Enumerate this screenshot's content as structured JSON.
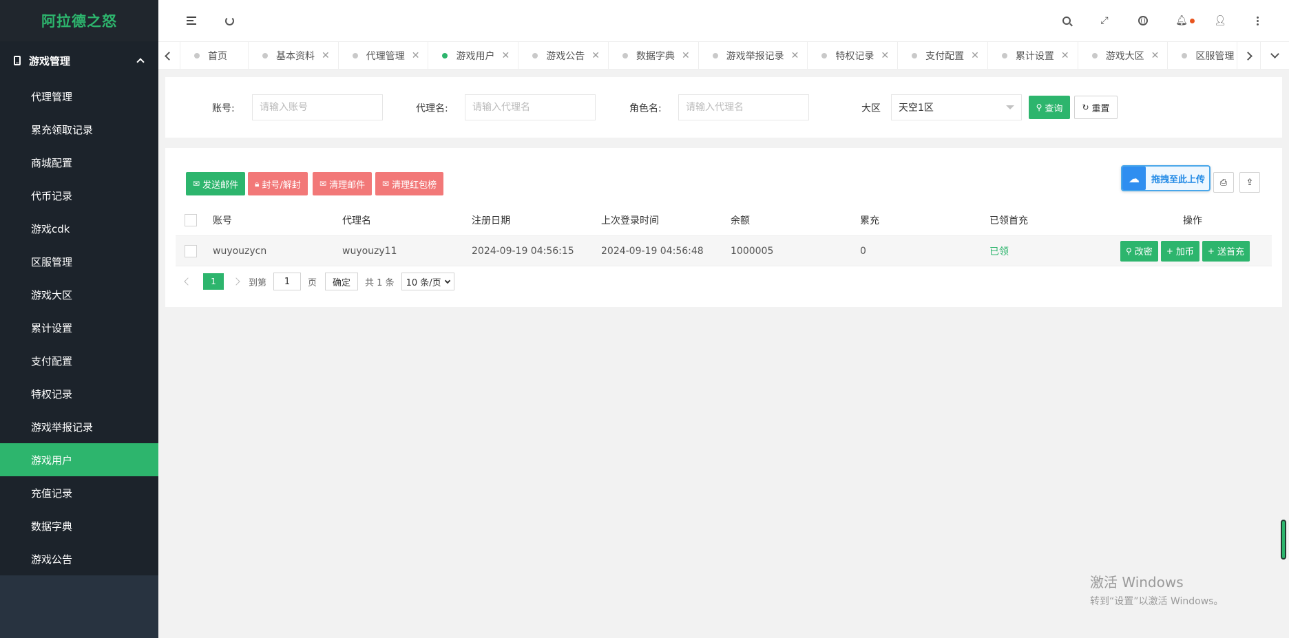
{
  "app": {
    "title": "阿拉德之怒"
  },
  "sidebar": {
    "group_label": "游戏管理",
    "items": [
      {
        "label": "代理管理"
      },
      {
        "label": "累充领取记录"
      },
      {
        "label": "商城配置"
      },
      {
        "label": "代币记录"
      },
      {
        "label": "游戏cdk"
      },
      {
        "label": "区服管理"
      },
      {
        "label": "游戏大区"
      },
      {
        "label": "累计设置"
      },
      {
        "label": "支付配置"
      },
      {
        "label": "特权记录"
      },
      {
        "label": "游戏举报记录"
      },
      {
        "label": "游戏用户",
        "active": true
      },
      {
        "label": "充值记录"
      },
      {
        "label": "数据字典"
      },
      {
        "label": "游戏公告"
      }
    ]
  },
  "tabs": [
    {
      "label": "首页",
      "closable": false
    },
    {
      "label": "基本资料",
      "closable": true
    },
    {
      "label": "代理管理",
      "closable": true
    },
    {
      "label": "游戏用户",
      "closable": true,
      "active": true
    },
    {
      "label": "游戏公告",
      "closable": true
    },
    {
      "label": "数据字典",
      "closable": true
    },
    {
      "label": "游戏举报记录",
      "closable": true
    },
    {
      "label": "特权记录",
      "closable": true
    },
    {
      "label": "支付配置",
      "closable": true
    },
    {
      "label": "累计设置",
      "closable": true
    },
    {
      "label": "游戏大区",
      "closable": true
    },
    {
      "label": "区服管理",
      "closable": true
    }
  ],
  "search": {
    "account_label": "账号:",
    "account_placeholder": "请输入账号",
    "agent_label": "代理名:",
    "agent_placeholder": "请输入代理名",
    "role_label": "角色名:",
    "role_placeholder": "请输入代理名",
    "region_label": "大区",
    "region_value": "天空1区",
    "query_label": "查询",
    "reset_label": "重置"
  },
  "toolbar": {
    "send_mail": "发送邮件",
    "ban_unban": "封号/解封",
    "clear_mail": "清理邮件",
    "clear_redlist": "清理红包榜",
    "upload_badge": "拖拽至此上传"
  },
  "table": {
    "headers": [
      "账号",
      "代理名",
      "注册日期",
      "上次登录时间",
      "余额",
      "累充",
      "已领首充",
      "操作"
    ],
    "rows": [
      {
        "account": "wuyouzycn",
        "agent": "wuyouzy11",
        "register_date": "2024-09-19 04:56:15",
        "last_login": "2024-09-19 04:56:48",
        "balance": "1000005",
        "total_recharge": "0",
        "first_recharge": "已领",
        "actions": {
          "change_pwd": "改密",
          "add_coin": "加币",
          "send_first": "送首充"
        }
      }
    ]
  },
  "pagination": {
    "current": "1",
    "goto_label": "到第",
    "goto_value": "1",
    "page_label": "页",
    "confirm_label": "确定",
    "total_label": "共 1 条",
    "page_size": "10 条/页"
  },
  "watermark": {
    "title": "激活 Windows",
    "subtitle": "转到“设置”以激活 Windows。"
  },
  "colors": {
    "accent": "#2db56d",
    "danger": "#f27878",
    "sidebar": "#283340"
  }
}
